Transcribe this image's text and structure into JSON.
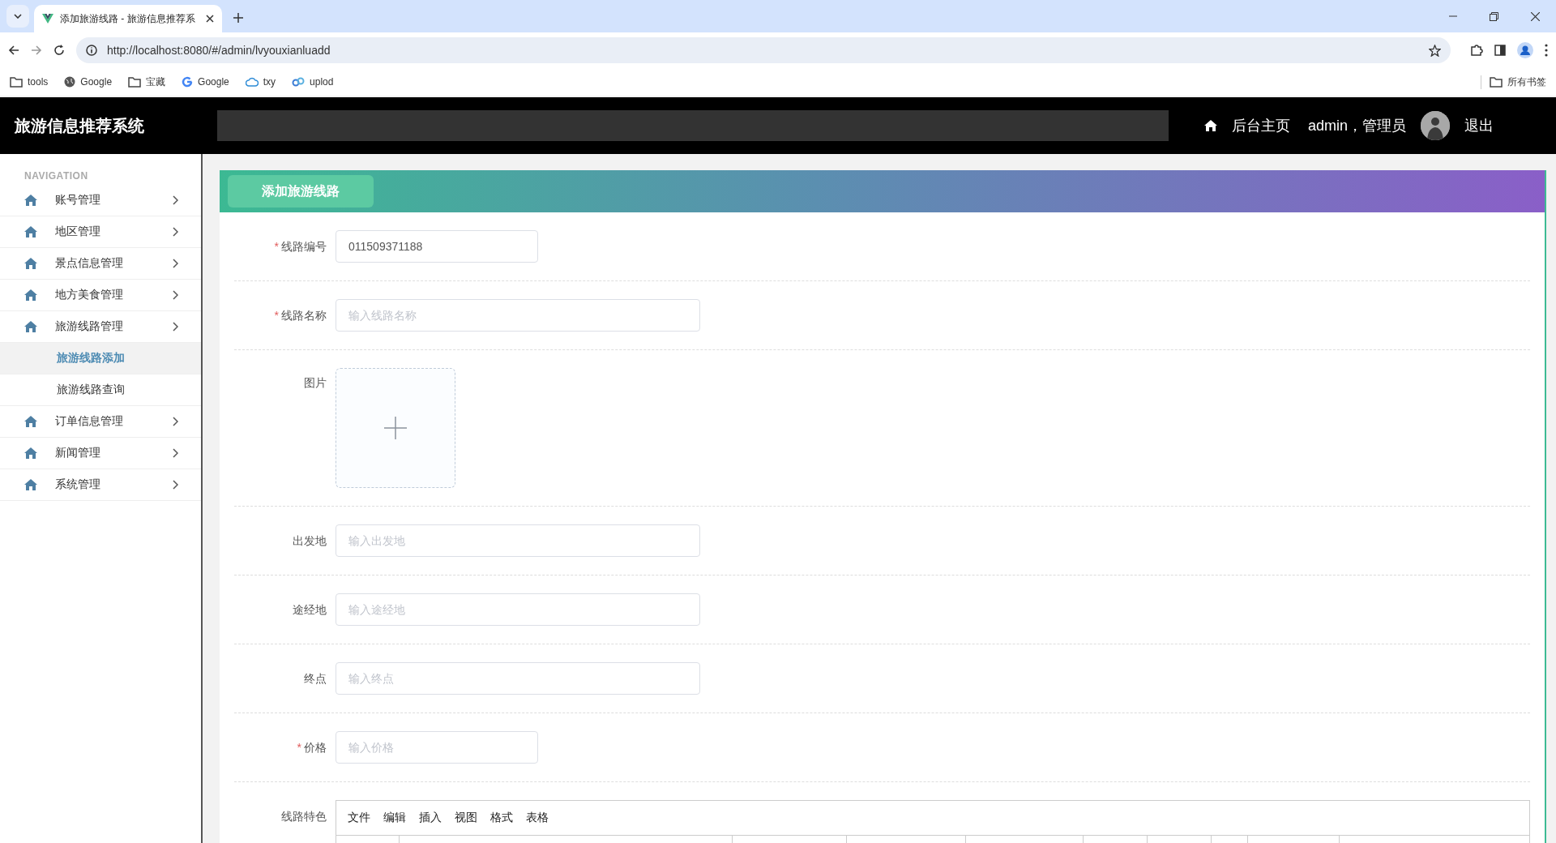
{
  "browser": {
    "tab_title": "添加旅游线路 - 旅游信息推荐系",
    "url": "http://localhost:8080/#/admin/lvyouxianluadd",
    "bookmarks": [
      {
        "label": "tools",
        "kind": "folder"
      },
      {
        "label": "Google",
        "kind": "globe"
      },
      {
        "label": "宝藏",
        "kind": "folder"
      },
      {
        "label": "Google",
        "kind": "google"
      },
      {
        "label": "txy",
        "kind": "cloud"
      },
      {
        "label": "uplod",
        "kind": "link"
      }
    ],
    "all_bookmarks": "所有书签"
  },
  "header": {
    "title": "旅游信息推荐系统",
    "home": "后台主页",
    "user": "admin，管理员",
    "logout": "退出"
  },
  "sidebar": {
    "heading": "NAVIGATION",
    "items": [
      {
        "label": "账号管理"
      },
      {
        "label": "地区管理"
      },
      {
        "label": "景点信息管理"
      },
      {
        "label": "地方美食管理"
      },
      {
        "label": "旅游线路管理",
        "children": [
          {
            "label": "旅游线路添加",
            "selected": true
          },
          {
            "label": "旅游线路查询",
            "selected": false
          }
        ]
      },
      {
        "label": "订单信息管理"
      },
      {
        "label": "新闻管理"
      },
      {
        "label": "系统管理"
      }
    ]
  },
  "form": {
    "title": "添加旅游线路",
    "fields": [
      {
        "kind": "short-text",
        "label": "线路编号",
        "required_mark": "*",
        "value": "011509371188"
      },
      {
        "kind": "text",
        "label": "线路名称",
        "required_mark": "*",
        "placeholder": "输入线路名称"
      },
      {
        "kind": "image",
        "label": "图片"
      },
      {
        "kind": "text",
        "label": "出发地",
        "placeholder": "输入出发地"
      },
      {
        "kind": "text",
        "label": "途经地",
        "placeholder": "输入途经地"
      },
      {
        "kind": "text",
        "label": "终点",
        "placeholder": "输入终点"
      },
      {
        "kind": "short-text",
        "label": "价格",
        "required_mark": "*",
        "placeholder": "输入价格"
      },
      {
        "kind": "editor",
        "label": "线路特色",
        "menu": [
          "文件",
          "编辑",
          "插入",
          "视图",
          "格式",
          "表格"
        ]
      }
    ]
  }
}
